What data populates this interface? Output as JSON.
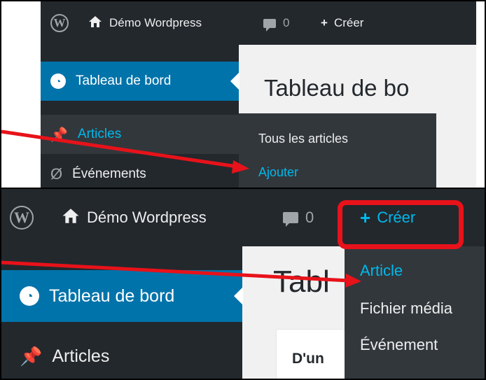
{
  "top_screenshot": {
    "adminbar": {
      "site_name": "Démo Wordpress",
      "comments_count": "0",
      "new_label": "Créer"
    },
    "sidebar": {
      "items": [
        {
          "label": "Tableau de bord",
          "icon": "dashboard-gauge-icon",
          "state": "current"
        },
        {
          "label": "Articles",
          "icon": "pushpin-icon",
          "state": "hover"
        },
        {
          "label": "Événements",
          "icon": "events-icon",
          "state": "default"
        }
      ]
    },
    "page_title": "Tableau de bo",
    "articles_submenu": [
      {
        "label": "Tous les articles",
        "state": "default"
      },
      {
        "label": "Ajouter",
        "state": "active"
      }
    ]
  },
  "bottom_screenshot": {
    "adminbar": {
      "site_name": "Démo Wordpress",
      "comments_count": "0",
      "new_label": "Créer"
    },
    "sidebar": {
      "items": [
        {
          "label": "Tableau de bord",
          "icon": "dashboard-gauge-icon",
          "state": "current"
        },
        {
          "label": "Articles",
          "icon": "pushpin-icon",
          "state": "default"
        }
      ]
    },
    "page_title": "Tabl",
    "widget_title": "D'un",
    "new_dropdown": [
      {
        "label": "Article",
        "state": "active"
      },
      {
        "label": "Fichier média",
        "state": "default"
      },
      {
        "label": "Événement",
        "state": "default"
      }
    ]
  },
  "colors": {
    "adminbar": "#23282d",
    "submenu": "#32373c",
    "current_menu": "#0073aa",
    "link_highlight": "#00b9eb",
    "annotation": "#e8121a"
  }
}
